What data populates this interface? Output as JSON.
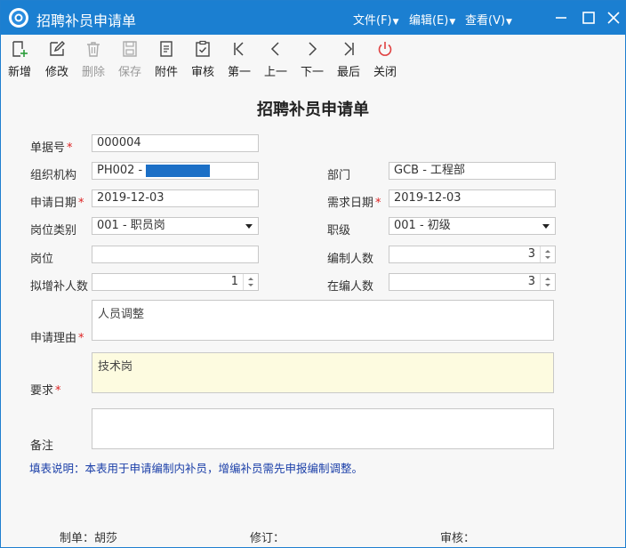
{
  "window": {
    "title": "招聘补员申请单",
    "menus": [
      "文件(F)",
      "编辑(E)",
      "查看(V)"
    ]
  },
  "toolbar": [
    {
      "id": "new",
      "label": "新增",
      "icon": "add-doc-icon",
      "enabled": true
    },
    {
      "id": "edit",
      "label": "修改",
      "icon": "pencil-icon",
      "enabled": true
    },
    {
      "id": "delete",
      "label": "删除",
      "icon": "trash-icon",
      "enabled": false
    },
    {
      "id": "save",
      "label": "保存",
      "icon": "floppy-icon",
      "enabled": false
    },
    {
      "id": "attach",
      "label": "附件",
      "icon": "document-icon",
      "enabled": true
    },
    {
      "id": "review",
      "label": "审核",
      "icon": "checklist-icon",
      "enabled": true
    },
    {
      "id": "first",
      "label": "第一",
      "icon": "first-icon",
      "enabled": true
    },
    {
      "id": "prev",
      "label": "上一",
      "icon": "prev-icon",
      "enabled": true
    },
    {
      "id": "next",
      "label": "下一",
      "icon": "next-icon",
      "enabled": true
    },
    {
      "id": "last",
      "label": "最后",
      "icon": "last-icon",
      "enabled": true
    },
    {
      "id": "close",
      "label": "关闭",
      "icon": "power-icon",
      "enabled": true
    }
  ],
  "form": {
    "title": "招聘补员申请单",
    "doc_no": {
      "label": "单据号",
      "value": "000004"
    },
    "org": {
      "label": "组织机构",
      "value": "PH002 -"
    },
    "dept": {
      "label": "部门",
      "value": "GCB - 工程部"
    },
    "apply_date": {
      "label": "申请日期",
      "value": "2019-12-03"
    },
    "need_date": {
      "label": "需求日期",
      "value": "2019-12-03"
    },
    "post_type": {
      "label": "岗位类别",
      "value": "001 - 职员岗"
    },
    "rank": {
      "label": "职级",
      "value": "001 - 初级"
    },
    "post": {
      "label": "岗位",
      "value": ""
    },
    "quota": {
      "label": "编制人数",
      "value": "3"
    },
    "add_count": {
      "label": "拟增补人数",
      "value": "1"
    },
    "current_count": {
      "label": "在编人数",
      "value": "3"
    },
    "reason": {
      "label": "申请理由",
      "value": "人员调整"
    },
    "requirement": {
      "label": "要求",
      "value": "技术岗"
    },
    "remark": {
      "label": "备注",
      "value": ""
    },
    "note": "填表说明：本表用于申请编制内补员，增编补员需先申报编制调整。"
  },
  "footer": {
    "maker": "制单：胡莎",
    "revise": "修订：",
    "auditor": "审核："
  },
  "colors": {
    "titlebar": "#1b7fd1",
    "required": "#d22222",
    "note": "#1b3fa8",
    "close_icon": "#e04040"
  }
}
